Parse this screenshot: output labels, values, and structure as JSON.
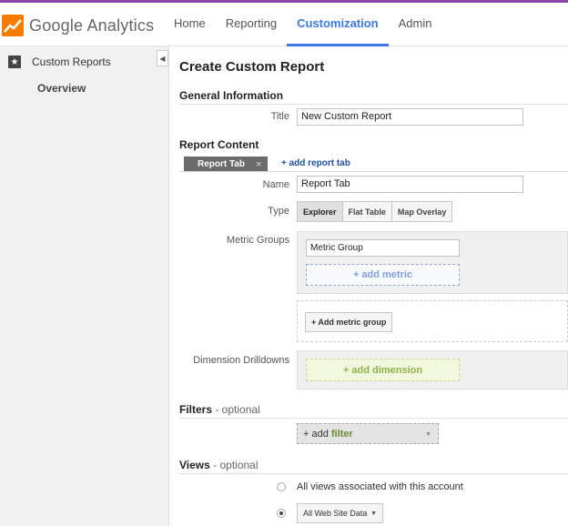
{
  "header": {
    "logo_text": "Google Analytics",
    "nav": [
      {
        "label": "Home",
        "active": false
      },
      {
        "label": "Reporting",
        "active": false
      },
      {
        "label": "Customization",
        "active": true
      },
      {
        "label": "Admin",
        "active": false
      }
    ],
    "accent_color": "#3b78e7"
  },
  "sidebar": {
    "item_label": "Custom Reports",
    "item_icon": "star-icon",
    "sub_label": "Overview",
    "collapse_icon": "chevron-left-icon"
  },
  "main": {
    "title": "Create Custom Report",
    "general": {
      "heading": "General Information",
      "title_label": "Title",
      "title_value": "New Custom Report"
    },
    "content": {
      "heading": "Report Content",
      "tab_label": "Report Tab",
      "tab_close": "×",
      "add_tab": "+ add report tab",
      "name_label": "Name",
      "name_value": "Report Tab",
      "type_label": "Type",
      "types": [
        "Explorer",
        "Flat Table",
        "Map Overlay"
      ],
      "metric_groups_label": "Metric Groups",
      "metric_group_value": "Metric Group",
      "add_metric": "+ add metric",
      "add_metric_group": "+ Add metric group",
      "dimension_label": "Dimension Drilldowns",
      "add_dimension": "+ add dimension"
    },
    "filters": {
      "heading": "Filters",
      "optional": " - optional",
      "add_prefix": "+ add",
      "add_word": "filter"
    },
    "views": {
      "heading": "Views",
      "optional": " - optional",
      "option_all": "All views associated with this account",
      "selected_view": "All Web Site Data"
    }
  }
}
